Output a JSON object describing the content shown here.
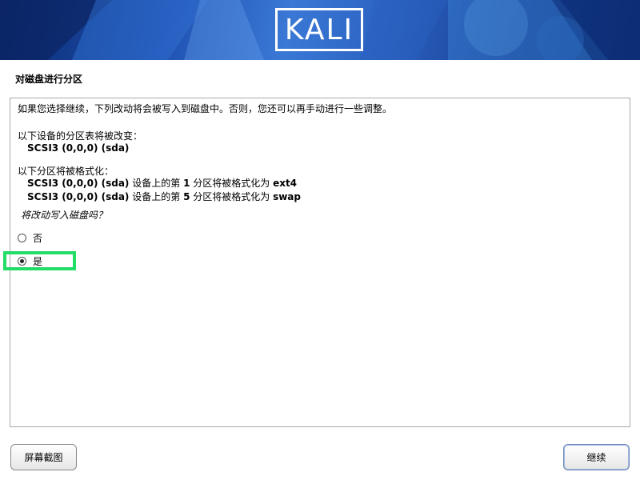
{
  "banner": {
    "logo_text": "KALI"
  },
  "page_title": "对磁盘进行分区",
  "content": {
    "intro": "如果您选择继续，下列改动将会被写入到磁盘中。否则，您还可以再手动进行一些调整。",
    "partition_table_heading": "以下设备的分区表将被改变：",
    "partition_table_device": "SCSI3 (0,0,0) (sda)",
    "format_heading": "以下分区将被格式化：",
    "format_lines": [
      {
        "device": "SCSI3 (0,0,0) (sda)",
        "prefix": " 设备上的第 ",
        "num": "1",
        "middle": " 分区将被格式化为 ",
        "fs": "ext4"
      },
      {
        "device": "SCSI3 (0,0,0) (sda)",
        "prefix": " 设备上的第 ",
        "num": "5",
        "middle": " 分区将被格式化为 ",
        "fs": "swap"
      }
    ],
    "question": "将改动写入磁盘吗？",
    "options": [
      {
        "label": "否",
        "checked": false
      },
      {
        "label": "是",
        "checked": true
      }
    ]
  },
  "buttons": {
    "screenshot": "屏幕截图",
    "continue": "继续"
  },
  "colors": {
    "highlight": "#22dd66",
    "banner": "#1e4fb0"
  }
}
